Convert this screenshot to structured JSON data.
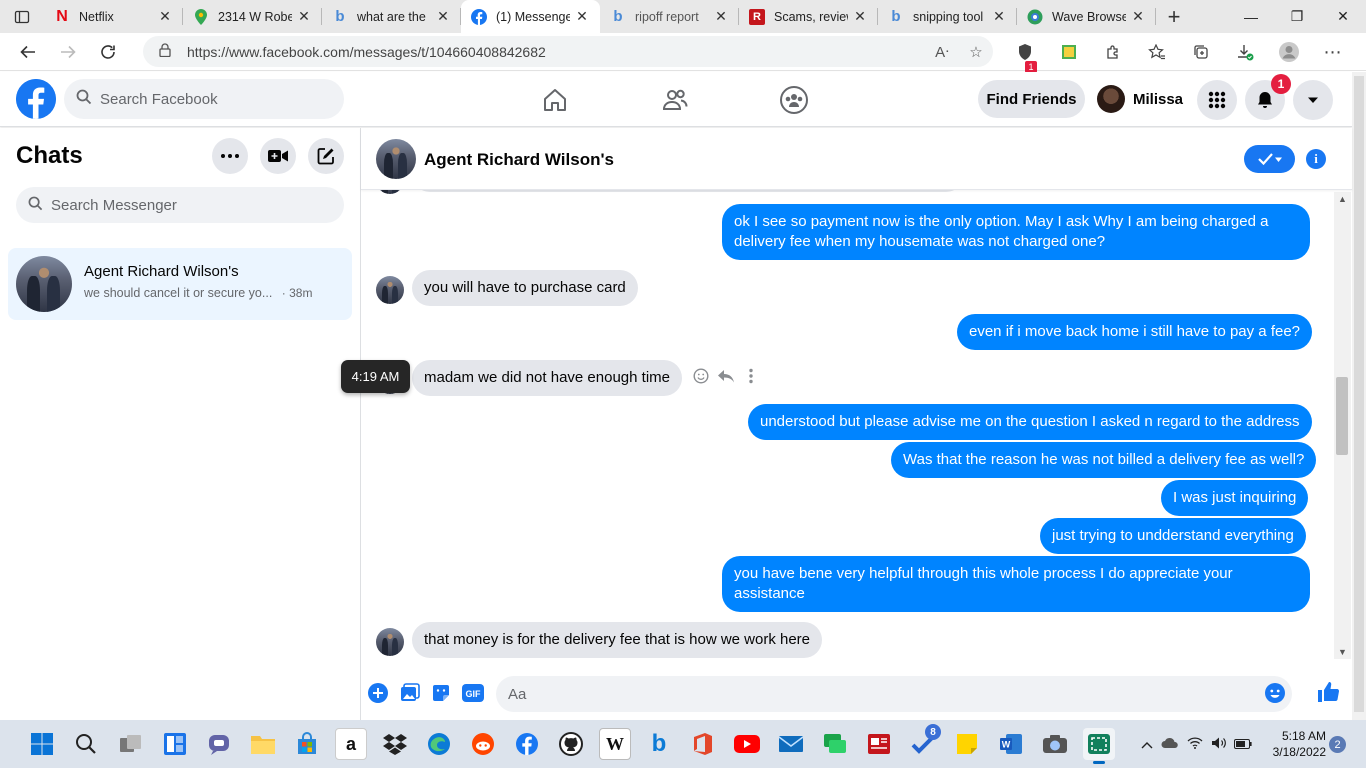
{
  "browser": {
    "tabs": [
      {
        "title": "Netflix",
        "icon": "netflix-icon",
        "color": "#e50914",
        "active": false
      },
      {
        "title": "2314 W Robe",
        "icon": "maps-pin-icon",
        "color": "#34a853",
        "active": false
      },
      {
        "title": "what are the",
        "icon": "bing-icon",
        "color": "#4a8ad6",
        "active": false
      },
      {
        "title": "(1) Messenge",
        "icon": "facebook-icon",
        "color": "#1877f2",
        "active": true
      },
      {
        "title": "ripoff report",
        "icon": "bing-icon",
        "color": "#4a8ad6",
        "active": false
      },
      {
        "title": "Scams, review",
        "icon": "ripoff-report-icon",
        "color": "#c4161c",
        "active": false
      },
      {
        "title": "snipping tool",
        "icon": "bing-icon",
        "color": "#4a8ad6",
        "active": false
      },
      {
        "title": "Wave Browse",
        "icon": "wave-browser-icon",
        "color": "#2e9e5b",
        "active": false
      }
    ],
    "url": "https://www.facebook.com/messages/t/104660408842682",
    "extension_badge": "1"
  },
  "facebook": {
    "search_placeholder": "Search Facebook",
    "find_friends": "Find Friends",
    "profile_name": "Milissa",
    "notification_count": "1"
  },
  "chats": {
    "title": "Chats",
    "search_placeholder": "Search Messenger",
    "items": [
      {
        "name": "Agent Richard Wilson's",
        "preview": "we should cancel it or secure yo...",
        "time": "· 38m"
      }
    ]
  },
  "conversation": {
    "contact_name": "Agent Richard Wilson's",
    "messages": [
      {
        "dir": "out",
        "text": "ok I see so payment now is the only option. May I ask Why I am being charged a delivery fee when my housemate was not charged one?"
      },
      {
        "dir": "in",
        "text": "you will have to purchase card"
      },
      {
        "dir": "out",
        "text": "even if i move back home i still have to pay a fee?"
      },
      {
        "dir": "in",
        "text": "madam we did not have enough time"
      },
      {
        "dir": "out",
        "text": "understood but please advise me on the question I asked n regard to the address"
      },
      {
        "dir": "out",
        "text": "Was that the reason he was not billed a delivery fee as well?"
      },
      {
        "dir": "out",
        "text": "I was just inquiring"
      },
      {
        "dir": "out",
        "text": "just trying to undderstand everything"
      },
      {
        "dir": "out",
        "text": "you have bene very helpful through this whole process I do appreciate your assistance"
      },
      {
        "dir": "in",
        "text": "that money is for the delivery fee that is how we work here"
      }
    ],
    "hover_timestamp": "4:19 AM",
    "composer_placeholder": "Aa"
  },
  "taskbar": {
    "time": "5:18 AM",
    "date": "3/18/2022",
    "notification_count": "2",
    "todo_badge": "8"
  }
}
